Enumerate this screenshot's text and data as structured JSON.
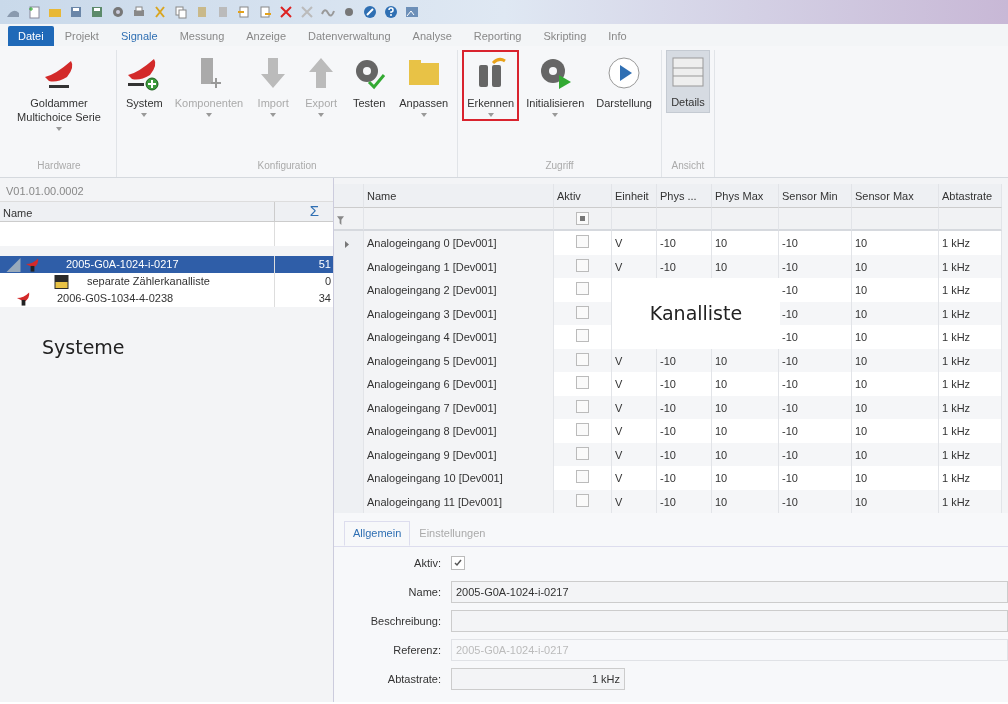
{
  "ribbon": {
    "tabs": [
      {
        "label": "Datei",
        "kind": "file",
        "selected": false
      },
      {
        "label": "Projekt",
        "kind": "tab",
        "selected": false
      },
      {
        "label": "Signale",
        "kind": "tab",
        "selected": true
      },
      {
        "label": "Messung",
        "kind": "tab",
        "selected": false
      },
      {
        "label": "Anzeige",
        "kind": "tab",
        "selected": false
      },
      {
        "label": "Datenverwaltung",
        "kind": "tab",
        "selected": false
      },
      {
        "label": "Analyse",
        "kind": "tab",
        "selected": false
      },
      {
        "label": "Reporting",
        "kind": "tab",
        "selected": false
      },
      {
        "label": "Skripting",
        "kind": "tab",
        "selected": false
      },
      {
        "label": "Info",
        "kind": "tab",
        "selected": false
      }
    ],
    "groups": [
      {
        "label": "Hardware",
        "buttons": [
          {
            "label": "Goldammer Multichoice Serie",
            "disabled": false,
            "dropdown": true,
            "highlighted": false,
            "selected": false
          }
        ]
      },
      {
        "label": "Konfiguration",
        "buttons": [
          {
            "label": "System",
            "disabled": false,
            "dropdown": true,
            "highlighted": false,
            "selected": false
          },
          {
            "label": "Komponenten",
            "disabled": true,
            "dropdown": true,
            "highlighted": false,
            "selected": false
          },
          {
            "label": "Import",
            "disabled": true,
            "dropdown": true,
            "highlighted": false,
            "selected": false
          },
          {
            "label": "Export",
            "disabled": true,
            "dropdown": true,
            "highlighted": false,
            "selected": false
          },
          {
            "label": "Testen",
            "disabled": false,
            "dropdown": false,
            "highlighted": false,
            "selected": false
          },
          {
            "label": "Anpassen",
            "disabled": false,
            "dropdown": true,
            "highlighted": false,
            "selected": false
          }
        ]
      },
      {
        "label": "Zugriff",
        "buttons": [
          {
            "label": "Erkennen",
            "disabled": false,
            "dropdown": true,
            "highlighted": true,
            "selected": false
          },
          {
            "label": "Initialisieren",
            "disabled": false,
            "dropdown": true,
            "highlighted": false,
            "selected": false
          },
          {
            "label": "Darstellung",
            "disabled": false,
            "dropdown": false,
            "highlighted": false,
            "selected": false
          }
        ]
      },
      {
        "label": "Ansicht",
        "buttons": [
          {
            "label": "Details",
            "disabled": false,
            "dropdown": false,
            "highlighted": false,
            "selected": true
          }
        ]
      }
    ]
  },
  "systems_panel": {
    "version": "V01.01.00.0002",
    "columns": [
      "Name",
      "Σ"
    ],
    "tree": [
      {
        "name": "2005-G0A-1024-i-0217",
        "count": "51",
        "selected": true,
        "expanded": true,
        "children": [
          {
            "name": "separate Zählerkanalliste",
            "count": "0",
            "selected": false
          }
        ]
      },
      {
        "name": "2006-G0S-1034-4-0238",
        "count": "34",
        "selected": false
      }
    ],
    "annotation": "Systeme"
  },
  "channel_grid": {
    "columns": [
      "Name",
      "Aktiv",
      "Einheit",
      "Phys ...",
      "Phys Max",
      "Sensor Min",
      "Sensor Max",
      "Abtastrate"
    ],
    "filter_aktiv_indeterminate": true,
    "rows": [
      {
        "name": "Analogeingang 0 [Dev001]",
        "aktiv": false,
        "current": true,
        "einheit": "V",
        "phys_min": "-10",
        "phys_max": "10",
        "sensor_min": "-10",
        "sensor_max": "10",
        "abtastrate": "1 kHz"
      },
      {
        "name": "Analogeingang 1 [Dev001]",
        "aktiv": false,
        "current": false,
        "einheit": "V",
        "phys_min": "-10",
        "phys_max": "10",
        "sensor_min": "-10",
        "sensor_max": "10",
        "abtastrate": "1 kHz"
      },
      {
        "name": "Analogeingang 2 [Dev001]",
        "aktiv": false,
        "current": false,
        "sensor_min": "-10",
        "sensor_max": "10",
        "abtastrate": "1 kHz"
      },
      {
        "name": "Analogeingang 3 [Dev001]",
        "aktiv": false,
        "current": false,
        "sensor_min": "-10",
        "sensor_max": "10",
        "abtastrate": "1 kHz"
      },
      {
        "name": "Analogeingang 4 [Dev001]",
        "aktiv": false,
        "current": false,
        "sensor_min": "-10",
        "sensor_max": "10",
        "abtastrate": "1 kHz"
      },
      {
        "name": "Analogeingang 5 [Dev001]",
        "aktiv": false,
        "current": false,
        "einheit": "V",
        "phys_min": "-10",
        "phys_max": "10",
        "sensor_min": "-10",
        "sensor_max": "10",
        "abtastrate": "1 kHz"
      },
      {
        "name": "Analogeingang 6 [Dev001]",
        "aktiv": false,
        "current": false,
        "einheit": "V",
        "phys_min": "-10",
        "phys_max": "10",
        "sensor_min": "-10",
        "sensor_max": "10",
        "abtastrate": "1 kHz"
      },
      {
        "name": "Analogeingang 7 [Dev001]",
        "aktiv": false,
        "current": false,
        "einheit": "V",
        "phys_min": "-10",
        "phys_max": "10",
        "sensor_min": "-10",
        "sensor_max": "10",
        "abtastrate": "1 kHz"
      },
      {
        "name": "Analogeingang 8 [Dev001]",
        "aktiv": false,
        "current": false,
        "einheit": "V",
        "phys_min": "-10",
        "phys_max": "10",
        "sensor_min": "-10",
        "sensor_max": "10",
        "abtastrate": "1 kHz"
      },
      {
        "name": "Analogeingang 9 [Dev001]",
        "aktiv": false,
        "current": false,
        "einheit": "V",
        "phys_min": "-10",
        "phys_max": "10",
        "sensor_min": "-10",
        "sensor_max": "10",
        "abtastrate": "1 kHz"
      },
      {
        "name": "Analogeingang 10 [Dev001]",
        "aktiv": false,
        "current": false,
        "einheit": "V",
        "phys_min": "-10",
        "phys_max": "10",
        "sensor_min": "-10",
        "sensor_max": "10",
        "abtastrate": "1 kHz"
      },
      {
        "name": "Analogeingang 11 [Dev001]",
        "aktiv": false,
        "current": false,
        "einheit": "V",
        "phys_min": "-10",
        "phys_max": "10",
        "sensor_min": "-10",
        "sensor_max": "10",
        "abtastrate": "1 kHz"
      }
    ],
    "annotation": "Kanalliste"
  },
  "details": {
    "tabs": [
      {
        "label": "Allgemein",
        "selected": true
      },
      {
        "label": "Einstellungen",
        "selected": false
      }
    ],
    "fields": [
      {
        "label": "Aktiv:",
        "kind": "checkbox",
        "checked": true
      },
      {
        "label": "Name:",
        "kind": "text",
        "value": "2005-G0A-1024-i-0217",
        "disabled": false
      },
      {
        "label": "Beschreibung:",
        "kind": "text",
        "disabled": false
      },
      {
        "label": "Referenz:",
        "kind": "text",
        "value": "2005-G0A-1024-i-0217",
        "disabled": true
      },
      {
        "label": "Abtastrate:",
        "kind": "number",
        "value": "1 kHz",
        "disabled": false
      }
    ]
  }
}
